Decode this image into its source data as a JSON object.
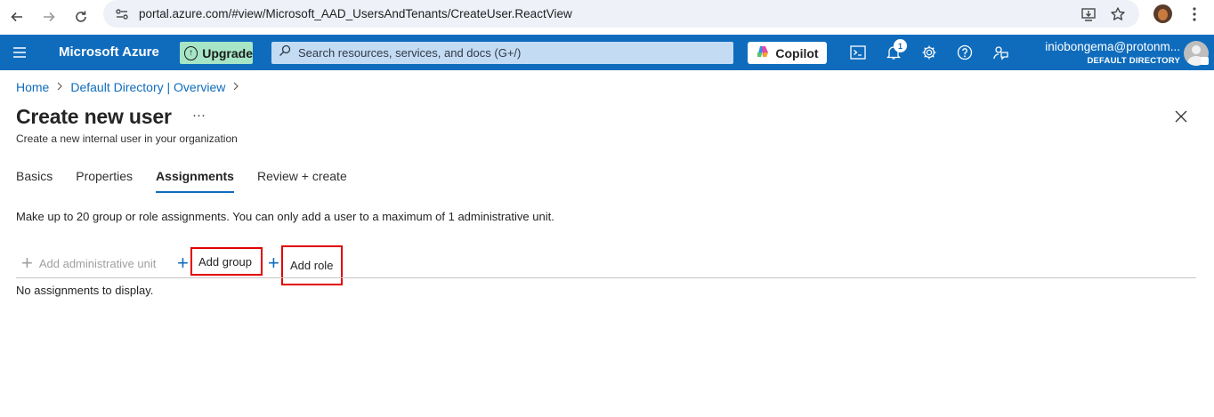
{
  "browser": {
    "url": "portal.azure.com/#view/Microsoft_AAD_UsersAndTenants/CreateUser.ReactView"
  },
  "topbar": {
    "brand": "Microsoft Azure",
    "upgrade_label": "Upgrade",
    "search_placeholder": "Search resources, services, and docs (G+/)",
    "copilot_label": "Copilot",
    "notification_count": "1",
    "user_email": "iniobongema@protonm...",
    "user_directory": "DEFAULT DIRECTORY",
    "brand_color": "#0f6cbd"
  },
  "breadcrumb": {
    "items": [
      "Home",
      "Default Directory | Overview"
    ]
  },
  "page": {
    "title": "Create new user",
    "more": "···",
    "subtitle": "Create a new internal user in your organization"
  },
  "tabs": [
    {
      "label": "Basics",
      "active": false
    },
    {
      "label": "Properties",
      "active": false
    },
    {
      "label": "Assignments",
      "active": true
    },
    {
      "label": "Review + create",
      "active": false
    }
  ],
  "content": {
    "info": "Make up to 20 group or role assignments. You can only add a user to a maximum of 1 administrative unit.",
    "toolbar": {
      "add_admin_unit": "Add administrative unit",
      "add_group": "Add group",
      "add_role": "Add role"
    },
    "empty_message": "No assignments to display."
  }
}
